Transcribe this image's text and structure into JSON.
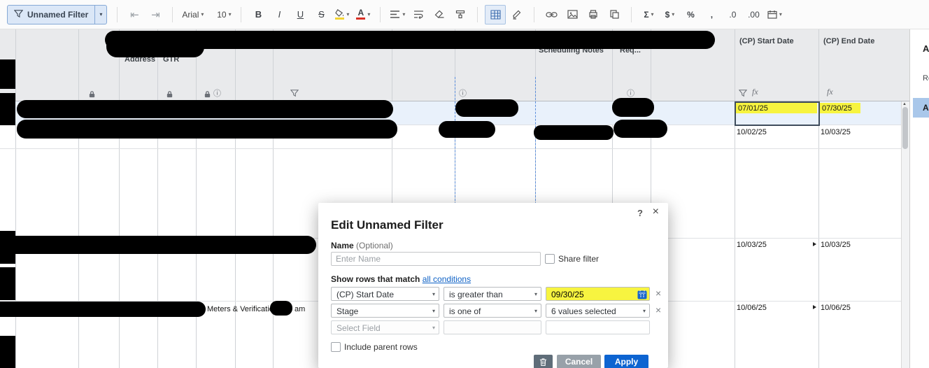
{
  "toolbar": {
    "filter_label": "Unnamed Filter",
    "font_name": "Arial",
    "font_size": "10",
    "bold": "B",
    "italic": "I",
    "underline": "U",
    "strikethrough": "S",
    "text_color_letter": "A",
    "sum": "Σ",
    "currency": "$",
    "percent": "%",
    "comma": ",",
    "decimal_decrease": ".0",
    "decimal_increase": ".00",
    "caret": "▾"
  },
  "grid": {
    "headers": {
      "address": "Address",
      "gtr": "GTR",
      "scheduling_notes": "Scheduling Notes",
      "req": "Req...",
      "cp_start": "(CP) Start Date",
      "cp_end": "(CP) End Date"
    },
    "icons": {
      "info": "ⓘ",
      "formula": "fx"
    },
    "rows": [
      {
        "cp_start": "07/01/25",
        "cp_end": "07/30/25"
      },
      {
        "cp_start": "10/02/25",
        "cp_end": "10/03/25"
      },
      {
        "cp_start": "10/03/25",
        "cp_end": "10/03/25"
      },
      {
        "cp_start": "10/06/25",
        "cp_end": "10/06/25"
      }
    ],
    "visible_cells": {
      "meters": "Meters & Verification",
      "time_fragment": "am"
    }
  },
  "modal": {
    "title": "Edit Unnamed Filter",
    "help": "?",
    "close": "×",
    "name_label": "Name",
    "name_optional": "(Optional)",
    "name_placeholder": "Enter Name",
    "share_filter_label": "Share filter",
    "match_text": "Show rows that match",
    "match_link": "all conditions",
    "conditions": [
      {
        "field": "(CP) Start Date",
        "operator": "is greater than",
        "value": "09/30/25"
      },
      {
        "field": "Stage",
        "operator": "is one of",
        "value": "6 values selected"
      },
      {
        "field": "Select Field",
        "operator": "",
        "value": ""
      }
    ],
    "remove": "×",
    "include_parent_rows_label": "Include parent rows",
    "cancel_label": "Cancel",
    "apply_label": "Apply"
  },
  "right_panel": {
    "fragment_top": "A",
    "fragment_mid": "Re",
    "fragment_selected": "A"
  },
  "colors": {
    "highlight_yellow": "#f7f440",
    "accent_blue": "#0f62c6",
    "apply_blue": "#0d64d1"
  }
}
